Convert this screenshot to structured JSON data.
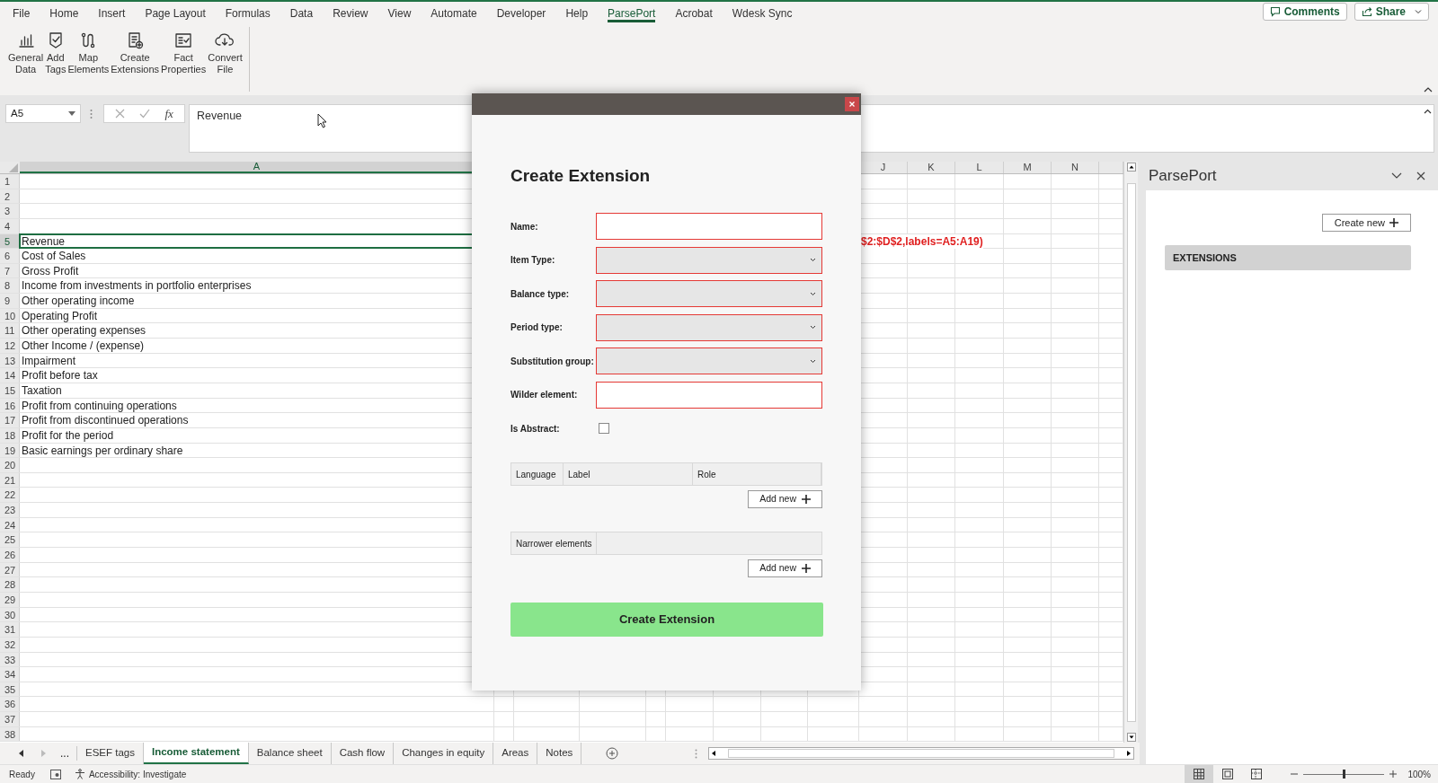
{
  "menu_tabs": [
    {
      "label": "File",
      "selected": false
    },
    {
      "label": "Home",
      "selected": false
    },
    {
      "label": "Insert",
      "selected": false
    },
    {
      "label": "Page Layout",
      "selected": false
    },
    {
      "label": "Formulas",
      "selected": false
    },
    {
      "label": "Data",
      "selected": false
    },
    {
      "label": "Review",
      "selected": false
    },
    {
      "label": "View",
      "selected": false
    },
    {
      "label": "Automate",
      "selected": false
    },
    {
      "label": "Developer",
      "selected": false
    },
    {
      "label": "Help",
      "selected": false
    },
    {
      "label": "ParsePort",
      "selected": true
    },
    {
      "label": "Acrobat",
      "selected": false
    },
    {
      "label": "Wdesk Sync",
      "selected": false
    }
  ],
  "header_buttons": [
    {
      "kind": "comments",
      "label": "Comments"
    },
    {
      "kind": "share",
      "label": "Share"
    }
  ],
  "ribbon_buttons": [
    {
      "kind": "chart",
      "lines": [
        "General",
        "Data"
      ]
    },
    {
      "kind": "tag",
      "lines": [
        "Add",
        "Tags"
      ]
    },
    {
      "kind": "map",
      "lines": [
        "Map",
        "Elements"
      ]
    },
    {
      "kind": "extension",
      "lines": [
        "Create",
        "Extensions"
      ]
    },
    {
      "kind": "fact",
      "lines": [
        "Fact",
        "Properties"
      ]
    },
    {
      "kind": "cloud",
      "lines": [
        "Convert",
        "File"
      ]
    }
  ],
  "name_box": "A5",
  "function_glyph": "fx",
  "formula": "Revenue",
  "columns": [
    {
      "header": "A",
      "selected": true
    },
    {
      "header": "J",
      "selected": false
    },
    {
      "header": "K",
      "selected": false
    },
    {
      "header": "L",
      "selected": false
    },
    {
      "header": "M",
      "selected": false
    },
    {
      "header": "N",
      "selected": false
    }
  ],
  "rows": [
    {
      "number": "1",
      "selected": false
    },
    {
      "number": "2",
      "selected": false
    },
    {
      "number": "3",
      "selected": false
    },
    {
      "number": "4",
      "selected": false
    },
    {
      "number": "5",
      "text": "Revenue",
      "selected": true,
      "spill": "$2:$D$2,labels=A5:A19)"
    },
    {
      "number": "6",
      "text": "Cost of Sales",
      "selected": false
    },
    {
      "number": "7",
      "text": "Gross Profit",
      "selected": false
    },
    {
      "number": "8",
      "text": "Income from investments in portfolio enterprises",
      "selected": false
    },
    {
      "number": "9",
      "text": "Other operating income",
      "selected": false
    },
    {
      "number": "10",
      "text": "Operating Profit",
      "selected": false
    },
    {
      "number": "11",
      "text": "Other operating expenses",
      "selected": false
    },
    {
      "number": "12",
      "text": "Other Income / (expense)",
      "selected": false
    },
    {
      "number": "13",
      "text": "Impairment",
      "selected": false
    },
    {
      "number": "14",
      "text": "Profit before tax",
      "selected": false
    },
    {
      "number": "15",
      "text": "Taxation",
      "selected": false
    },
    {
      "number": "16",
      "text": "Profit from continuing operations",
      "selected": false
    },
    {
      "number": "17",
      "text": "Profit from discontinued operations",
      "selected": false
    },
    {
      "number": "18",
      "text": "Profit for the period",
      "selected": false
    },
    {
      "number": "19",
      "text": "Basic earnings per ordinary share",
      "selected": false
    },
    {
      "number": "20",
      "selected": false
    },
    {
      "number": "21",
      "selected": false
    },
    {
      "number": "22",
      "selected": false
    },
    {
      "number": "23",
      "selected": false
    },
    {
      "number": "24",
      "selected": false
    },
    {
      "number": "25",
      "selected": false
    },
    {
      "number": "26",
      "selected": false
    },
    {
      "number": "27",
      "selected": false
    },
    {
      "number": "28",
      "selected": false
    },
    {
      "number": "29",
      "selected": false
    },
    {
      "number": "30",
      "selected": false
    },
    {
      "number": "31",
      "selected": false
    },
    {
      "number": "32",
      "selected": false
    },
    {
      "number": "33",
      "selected": false
    },
    {
      "number": "34",
      "selected": false
    },
    {
      "number": "35",
      "selected": false
    },
    {
      "number": "36",
      "selected": false
    },
    {
      "number": "37",
      "selected": false
    },
    {
      "number": "38",
      "selected": false
    }
  ],
  "dialog": {
    "title": "Create Extension",
    "fields": [
      {
        "label": "Name:",
        "kind": "text",
        "invalid": true
      },
      {
        "label": "Item Type:",
        "kind": "select",
        "invalid": true
      },
      {
        "label": "Balance type:",
        "kind": "select",
        "invalid": true
      },
      {
        "label": "Period type:",
        "kind": "select",
        "invalid": true
      },
      {
        "label": "Substitution group:",
        "kind": "select",
        "invalid": true
      },
      {
        "label": "Wilder element:",
        "kind": "text",
        "invalid": true
      },
      {
        "label": "Is Abstract:",
        "kind": "checkbox",
        "checked": false
      }
    ],
    "label_table": {
      "columns": [
        "Language",
        "Label",
        "Role"
      ],
      "add_button": "Add new"
    },
    "narrower_table": {
      "columns": [
        "Narrower elements"
      ],
      "add_button": "Add new"
    },
    "submit": "Create Extension"
  },
  "task_pane": {
    "title": "ParsePort",
    "create_button": "Create new",
    "section": "EXTENSIONS"
  },
  "sheet_more": "...",
  "sheet_tabs": [
    {
      "label": "ESEF tags",
      "selected": false
    },
    {
      "label": "Income statement",
      "selected": true
    },
    {
      "label": "Balance sheet",
      "selected": false
    },
    {
      "label": "Cash flow",
      "selected": false
    },
    {
      "label": "Changes in equity",
      "selected": false
    },
    {
      "label": "Areas",
      "selected": false
    },
    {
      "label": "Notes",
      "selected": false
    }
  ],
  "status_bar": {
    "ready": "Ready",
    "accessibility": "Accessibility: Investigate",
    "view_modes": [
      {
        "kind": "normal",
        "selected": true
      },
      {
        "kind": "page-layout",
        "selected": false
      },
      {
        "kind": "page-break",
        "selected": false
      }
    ],
    "zoom": {
      "level": 0.5
    },
    "zoom_text": "100%"
  }
}
